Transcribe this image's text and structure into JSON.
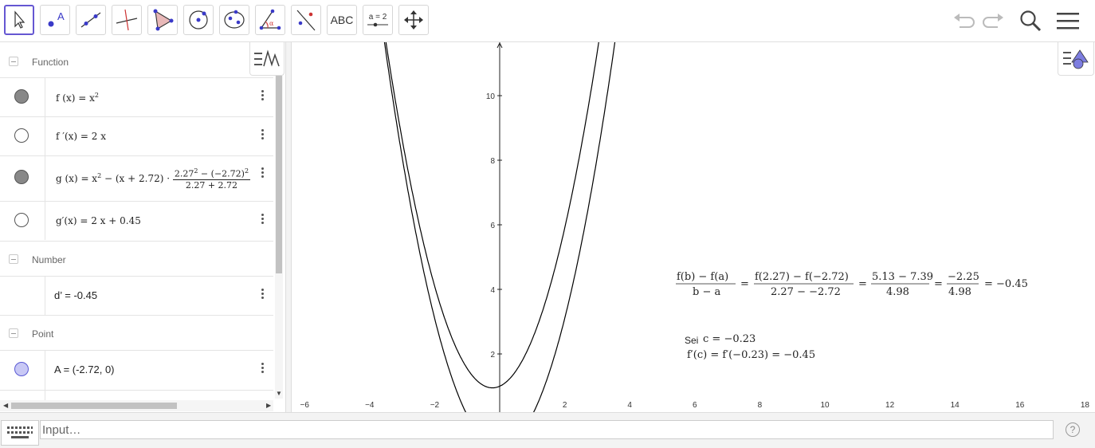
{
  "toolbar": {
    "tools": [
      {
        "name": "move-tool",
        "icon": "arrow-icon"
      },
      {
        "name": "point-tool",
        "icon": "point-icon",
        "label": "A"
      },
      {
        "name": "line-tool",
        "icon": "line-icon"
      },
      {
        "name": "perpendicular-tool",
        "icon": "perpendicular-icon"
      },
      {
        "name": "polygon-tool",
        "icon": "polygon-icon"
      },
      {
        "name": "circle-tool",
        "icon": "circle-icon"
      },
      {
        "name": "conic-tool",
        "icon": "ellipse-icon"
      },
      {
        "name": "angle-tool",
        "icon": "angle-icon",
        "label": "α"
      },
      {
        "name": "reflect-tool",
        "icon": "reflect-icon"
      },
      {
        "name": "text-tool",
        "icon": "text-icon",
        "label": "ABC"
      },
      {
        "name": "slider-tool",
        "icon": "slider-icon",
        "label": "a = 2"
      },
      {
        "name": "move-graphics-tool",
        "icon": "move-cross-icon"
      }
    ],
    "right": [
      "undo-icon",
      "redo-icon",
      "search-icon",
      "menu-icon"
    ]
  },
  "algebra": {
    "groups": {
      "function": "Function",
      "number": "Number",
      "point": "Point"
    },
    "rows": {
      "f": {
        "lhs": "f (x)  =  x",
        "exp": "2"
      },
      "fp": {
        "text": "f ′(x)  =  2 x"
      },
      "g": {
        "lhs": "g (x)  =  x",
        "exp": "2",
        "mid": " − (x + 2.72) · ",
        "num": "2.27",
        "num_exp": "2",
        "num_rest": " − (−2.72)",
        "num_exp2": "2",
        "den": "2.27 + 2.72"
      },
      "gp": {
        "text": "g′(x)  =  2 x + 0.45"
      },
      "d": {
        "text": "d’ = -0.45"
      },
      "A": {
        "text": "A = (-2.72, 0)"
      }
    }
  },
  "graphics": {
    "x_ticks": [
      "−6",
      "−4",
      "−2",
      "2",
      "4",
      "6",
      "8",
      "10",
      "12",
      "14",
      "16",
      "18"
    ],
    "y_ticks": [
      "2",
      "4",
      "6",
      "8",
      "10"
    ],
    "formula": {
      "f1_num": "f(b) − f(a)",
      "f1_den": "b − a",
      "eq": "=",
      "f2_num": "f(2.27) − f(−2.72)",
      "f2_den": "2.27 − −2.72",
      "f3_num": "5.13 − 7.39",
      "f3_den": "4.98",
      "f4_num": "−2.25",
      "f4_den": "4.98",
      "result": "= −0.45"
    },
    "sei": {
      "label": "Sei",
      "c_eq": "c = −0.23",
      "fc_eq": "f′(c) = f′(−0.23) = −0.45"
    }
  },
  "inputbar": {
    "placeholder": "Input…",
    "help": "?"
  },
  "colors": {
    "accent": "#6557d2",
    "curve": "#000000",
    "point_fill": "#c8c8f5"
  }
}
